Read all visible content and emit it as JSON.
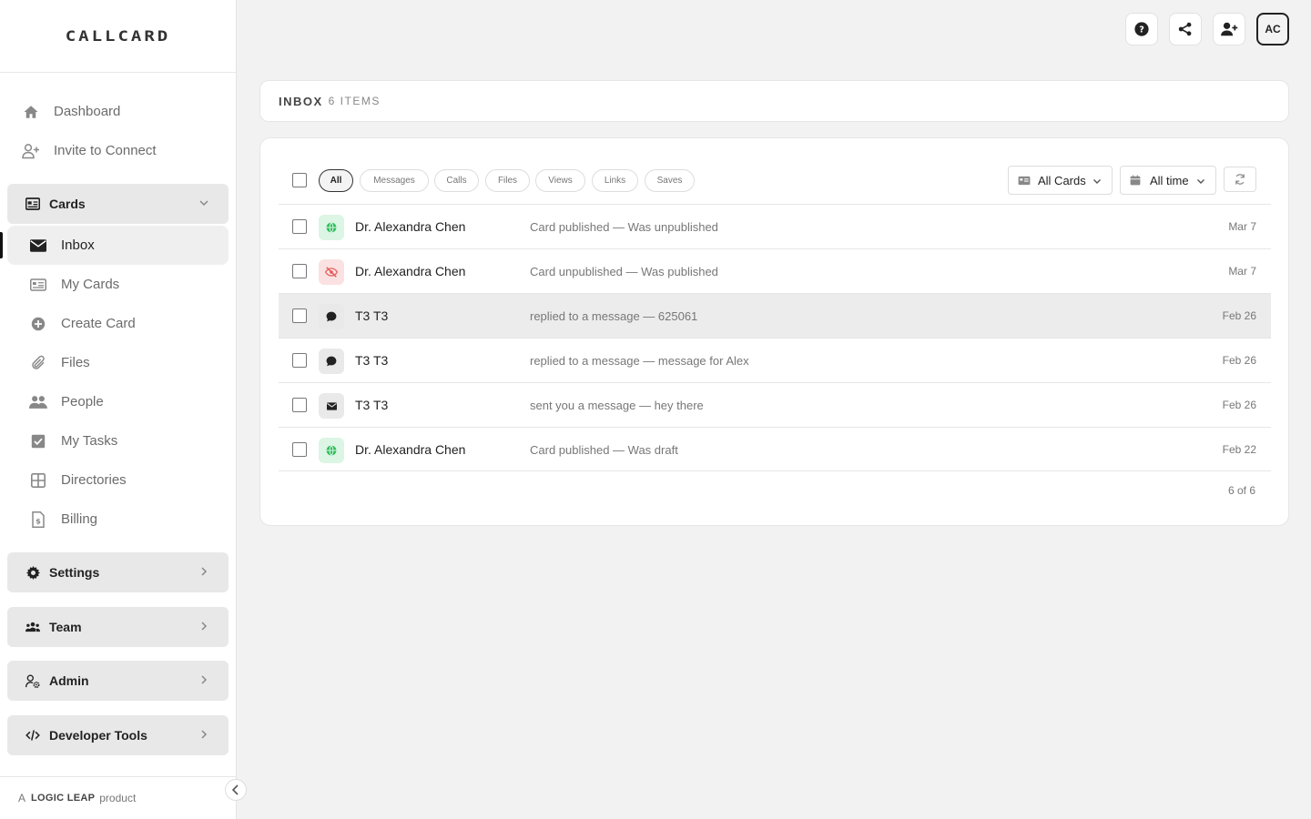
{
  "app": {
    "logo": "CALLCARD"
  },
  "nav": {
    "top": [
      {
        "label": "Dashboard",
        "icon": "home-icon"
      },
      {
        "label": "Invite to Connect",
        "icon": "user-plus-icon"
      }
    ],
    "cards_section": {
      "label": "Cards",
      "icon": "id-card-icon"
    },
    "cards_items": [
      {
        "label": "Inbox",
        "icon": "envelope-icon",
        "active": true
      },
      {
        "label": "My Cards",
        "icon": "card-list-icon"
      },
      {
        "label": "Create Card",
        "icon": "plus-circle-icon"
      },
      {
        "label": "Files",
        "icon": "paperclip-icon"
      },
      {
        "label": "People",
        "icon": "people-icon"
      },
      {
        "label": "My Tasks",
        "icon": "check-square-icon"
      },
      {
        "label": "Directories",
        "icon": "grid-icon"
      },
      {
        "label": "Billing",
        "icon": "dollar-file-icon"
      }
    ],
    "sections": [
      {
        "label": "Settings",
        "icon": "gear-icon"
      },
      {
        "label": "Team",
        "icon": "team-icon"
      },
      {
        "label": "Admin",
        "icon": "user-gear-icon"
      },
      {
        "label": "Developer Tools",
        "icon": "code-icon"
      }
    ]
  },
  "footer": {
    "prefix": "A",
    "brand": "LOGIC LEAP",
    "suffix": "product"
  },
  "header": {
    "avatar_initials": "AC"
  },
  "inbox": {
    "title": "INBOX",
    "count_label": "6 ITEMS",
    "filters": [
      "All",
      "Messages",
      "Calls",
      "Files",
      "Views",
      "Links",
      "Saves"
    ],
    "active_filter": "All",
    "card_filter": "All Cards",
    "time_filter": "All time",
    "rows": [
      {
        "name": "Dr. Alexandra Chen",
        "desc": "Card published — Was unpublished",
        "date": "Mar 7",
        "icon": "globe-icon",
        "tone": "green"
      },
      {
        "name": "Dr. Alexandra Chen",
        "desc": "Card unpublished — Was published",
        "date": "Mar 7",
        "icon": "eye-slash-icon",
        "tone": "red"
      },
      {
        "name": "T3 T3",
        "desc": "replied to a message — 625061",
        "date": "Feb 26",
        "icon": "chat-bubble-icon",
        "tone": "gray",
        "highlighted": true
      },
      {
        "name": "T3 T3",
        "desc": "replied to a message — message for Alex",
        "date": "Feb 26",
        "icon": "chat-bubble-icon",
        "tone": "gray"
      },
      {
        "name": "T3 T3",
        "desc": "sent you a message — hey there",
        "date": "Feb 26",
        "icon": "envelope-icon",
        "tone": "gray"
      },
      {
        "name": "Dr. Alexandra Chen",
        "desc": "Card published — Was draft",
        "date": "Feb 22",
        "icon": "globe-icon",
        "tone": "green"
      }
    ],
    "pagination": "6 of 6"
  }
}
